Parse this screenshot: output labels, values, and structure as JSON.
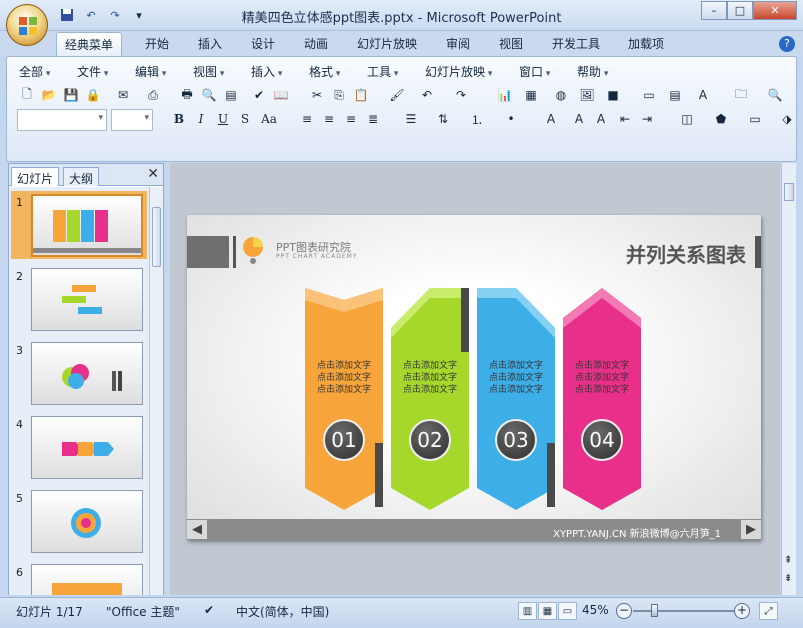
{
  "window": {
    "title": "精美四色立体感ppt图表.pptx - Microsoft PowerPoint",
    "min": "–",
    "max": "□",
    "close": "✕"
  },
  "ribbon_tabs": [
    "经典菜单",
    "开始",
    "插入",
    "设计",
    "动画",
    "幻灯片放映",
    "审阅",
    "视图",
    "开发工具",
    "加载项"
  ],
  "menus": [
    "全部",
    "文件",
    "编辑",
    "视图",
    "插入",
    "格式",
    "工具",
    "幻灯片放映",
    "窗口",
    "帮助"
  ],
  "format_buttons": [
    "B",
    "I",
    "U",
    "S",
    "Aa"
  ],
  "pane": {
    "tab_slides": "幻灯片",
    "tab_outline": "大纲",
    "close": "✕"
  },
  "thumbnails": [
    "1",
    "2",
    "3",
    "4",
    "5",
    "6"
  ],
  "slide": {
    "brand_cn": "PPT图表研究院",
    "brand_en": "PPT CHART ACADEMY",
    "title": "并列关系图表",
    "cards": [
      {
        "line": "点击添加文字",
        "num": "01",
        "color": "#f7a43a"
      },
      {
        "line": "点击添加文字",
        "num": "02",
        "color": "#a6d82c"
      },
      {
        "line": "点击添加文字",
        "num": "03",
        "color": "#3eaee8"
      },
      {
        "line": "点击添加文字",
        "num": "04",
        "color": "#e8308a"
      }
    ],
    "footer": "XYPPT.YANJ.CN  新浪微博@六月笋_1",
    "prev": "◀",
    "next": "▶"
  },
  "status": {
    "slide": "幻灯片 1/17",
    "theme": "\"Office 主题\"",
    "lang": "中文(简体，中国)",
    "zoom": "45%"
  }
}
